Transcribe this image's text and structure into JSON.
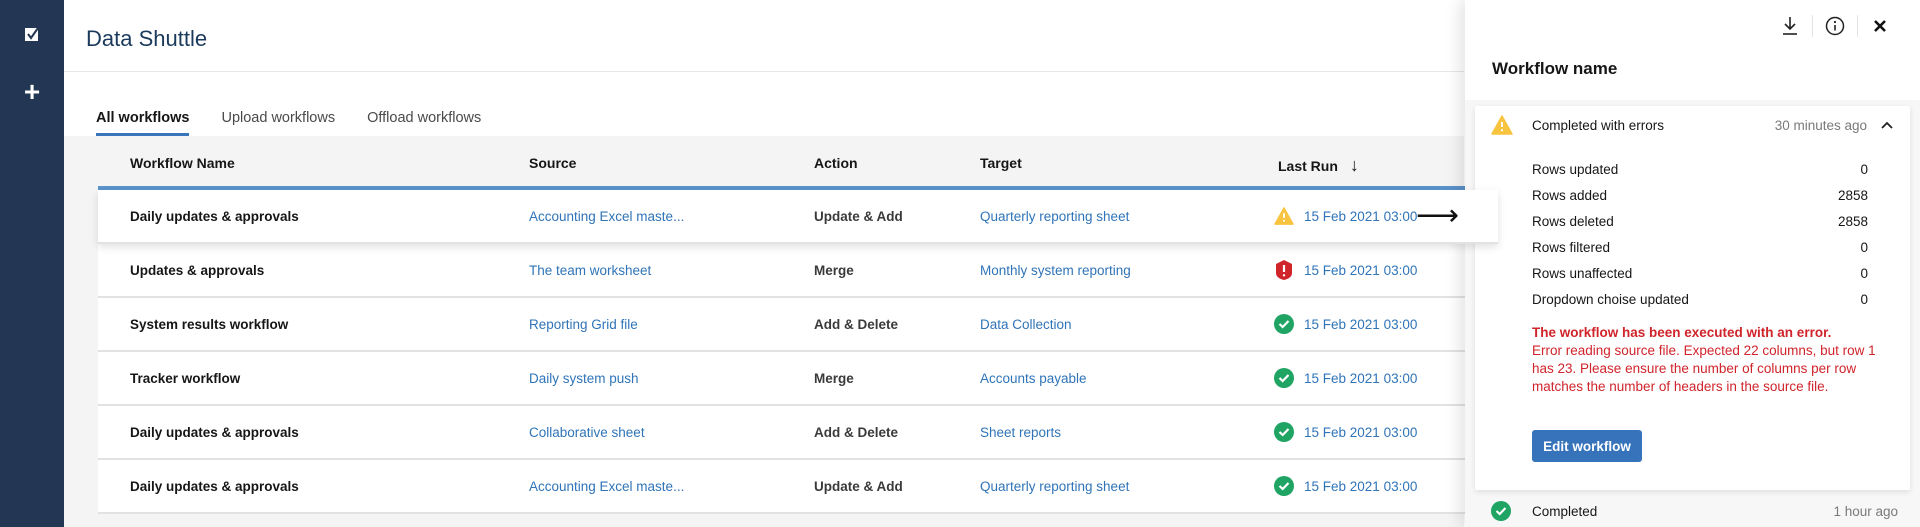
{
  "app": {
    "title": "Data Shuttle",
    "rail": {
      "logo_icon": "checkbox-logo-icon",
      "add_icon": "plus-icon",
      "add_symbol": "+"
    }
  },
  "tabs": [
    {
      "label": "All workflows",
      "active": true
    },
    {
      "label": "Upload workflows",
      "active": false
    },
    {
      "label": "Offload  workflows",
      "active": false
    }
  ],
  "table": {
    "columns": {
      "name": "Workflow Name",
      "source": "Source",
      "action": "Action",
      "target": "Target",
      "last_run": "Last Run",
      "sort_icon": "arrow-down-icon",
      "sort_symbol": "↓"
    },
    "rows": [
      {
        "name": "Daily updates & approvals",
        "source": "Accounting Excel maste...",
        "action": "Update & Add",
        "target": "Quarterly reporting sheet",
        "status": "warning",
        "last_run": "15 Feb 2021 03:00",
        "selected": true
      },
      {
        "name": "Updates & approvals",
        "source": "The team worksheet",
        "action": "Merge",
        "target": "Monthly system reporting",
        "status": "error",
        "last_run": "15 Feb 2021 03:00",
        "selected": false
      },
      {
        "name": "System results workflow",
        "source": "Reporting Grid file",
        "action": "Add & Delete",
        "target": "Data Collection",
        "status": "success",
        "last_run": "15 Feb 2021 03:00",
        "selected": false
      },
      {
        "name": "Tracker workflow",
        "source": "Daily system push",
        "action": "Merge",
        "target": "Accounts payable",
        "status": "success",
        "last_run": "15 Feb 2021 03:00",
        "selected": false
      },
      {
        "name": "Daily updates & approvals",
        "source": "Collaborative sheet",
        "action": "Add & Delete",
        "target": "Sheet reports",
        "status": "success",
        "last_run": "15 Feb 2021 03:00",
        "selected": false
      },
      {
        "name": "Daily updates & approvals",
        "source": "Accounting Excel maste...",
        "action": "Update & Add",
        "target": "Quarterly reporting sheet",
        "status": "success",
        "last_run": "15 Feb 2021 03:00",
        "selected": false
      }
    ],
    "row_arrow_symbol": "⟶"
  },
  "panel": {
    "title": "Workflow name",
    "actions": {
      "download": "download-icon",
      "info": "info-icon",
      "close": "close-icon"
    },
    "current_run": {
      "status": "Completed with errors",
      "time": "30 minutes ago",
      "stats": [
        {
          "label": "Rows updated",
          "value": "0"
        },
        {
          "label": "Rows added",
          "value": "2858"
        },
        {
          "label": "Rows deleted",
          "value": "2858"
        },
        {
          "label": "Rows filtered",
          "value": "0"
        },
        {
          "label": "Rows unaffected",
          "value": "0"
        },
        {
          "label": "Dropdown choise updated",
          "value": "0"
        }
      ],
      "error_title": "The workflow has been executed with an error.",
      "error_message": "Error reading source file. Expected 22 columns, but row 1 has 23. Please ensure the number of columns per row matches the number of headers in the source file.",
      "edit_button": "Edit workflow"
    },
    "history": [
      {
        "status": "Completed",
        "time": "1 hour ago"
      }
    ]
  },
  "colors": {
    "rail": "#233653",
    "accent": "#3673bb",
    "link": "#2f74b8",
    "warning": "#f8c43f",
    "error": "#d0242b",
    "success": "#1fa463"
  }
}
